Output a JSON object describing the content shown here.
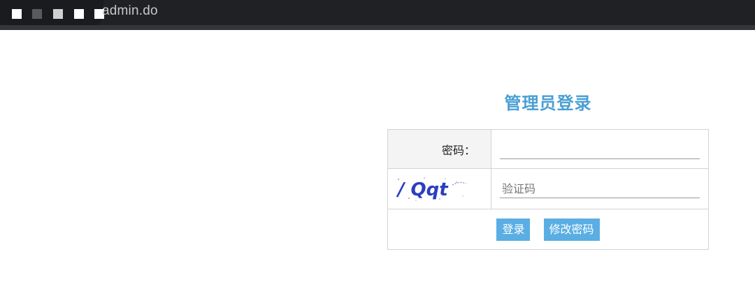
{
  "browser": {
    "url_fragment": "admin.do",
    "redaction_squares": [
      "#ffffff",
      "#5a5a5e",
      "#d0d0d0",
      "#ffffff",
      "#ffffff"
    ]
  },
  "login": {
    "title": "管理员登录",
    "password_label": "密码：",
    "password_value": "",
    "captcha_text": "/ Qqt",
    "captcha_placeholder": "验证码",
    "login_button": "登录",
    "change_password_button": "修改密码",
    "accent_color": "#4a9fd4",
    "button_color": "#5aaee3"
  }
}
